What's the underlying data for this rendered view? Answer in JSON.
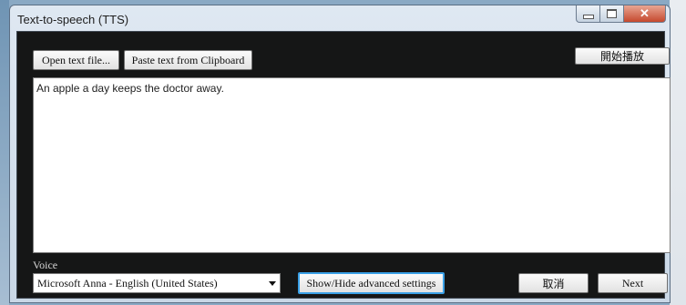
{
  "window": {
    "title": "Text-to-speech (TTS)"
  },
  "toolbar": {
    "open_file": "Open text file...",
    "paste_clipboard": "Paste text from Clipboard",
    "start_play": "開始播放"
  },
  "editor": {
    "text": "An apple a day keeps the doctor away."
  },
  "voice": {
    "label": "Voice",
    "selected": "Microsoft Anna - English (United States)"
  },
  "footer": {
    "advanced": "Show/Hide advanced settings",
    "cancel": "取消",
    "next": "Next"
  },
  "icons": {
    "minimize": "minimize-icon",
    "maximize": "maximize-icon",
    "close": "close-icon",
    "dropdown": "chevron-down-icon"
  },
  "colors": {
    "client_bg": "#151616",
    "close_button": "#c6492e",
    "focus_border": "#3aa0e6"
  }
}
